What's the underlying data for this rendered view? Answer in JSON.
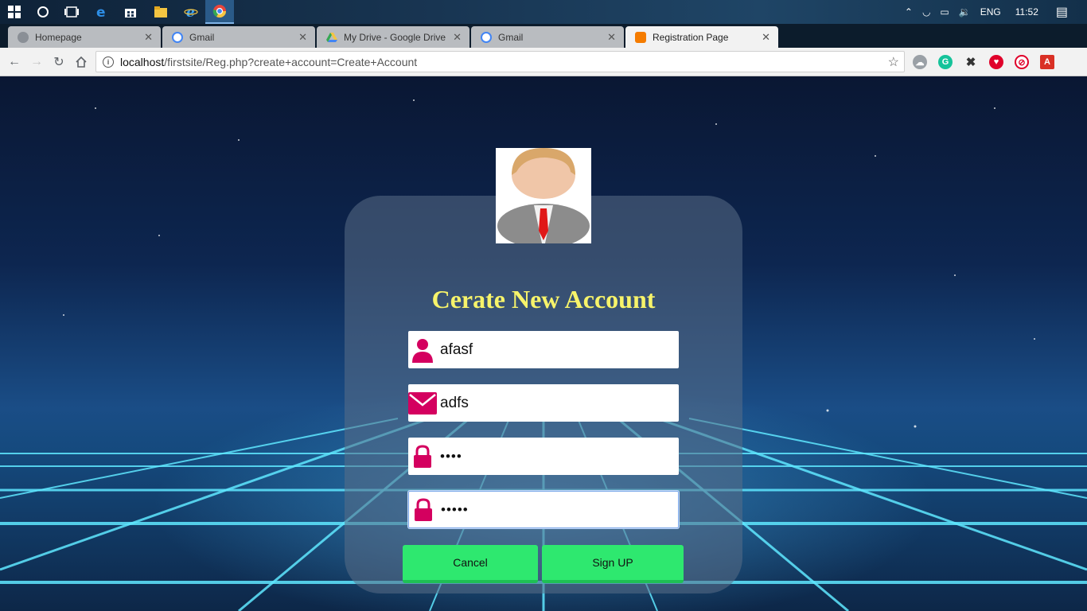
{
  "browser": {
    "tabs": [
      {
        "title": "Homepage",
        "favicon": "globe-icon",
        "active": false
      },
      {
        "title": "Gmail",
        "favicon": "google-icon",
        "active": false
      },
      {
        "title": "My Drive - Google Drive",
        "favicon": "drive-icon",
        "active": false
      },
      {
        "title": "Gmail",
        "favicon": "google-icon",
        "active": false
      },
      {
        "title": "Registration Page",
        "favicon": "xampp-icon",
        "active": true
      }
    ],
    "url_host": "localhost",
    "url_path": "/firstsite/Reg.php?create+account=Create+Account"
  },
  "taskbar": {
    "language": "ENG",
    "time": "11:52"
  },
  "form": {
    "title": "Cerate New Account",
    "fields": [
      {
        "icon": "user-icon",
        "value": "afasf",
        "type": "text"
      },
      {
        "icon": "envelope-icon",
        "value": "adfs",
        "type": "text"
      },
      {
        "icon": "lock-icon",
        "value": "••••",
        "type": "password"
      },
      {
        "icon": "lock-icon",
        "value": "•••••",
        "type": "password"
      }
    ],
    "cancel_label": "Cancel",
    "signup_label": "Sign UP"
  },
  "colors": {
    "accent_pink": "#d4005f",
    "button_green": "#2ee86f",
    "title_yellow": "#f7f36a"
  }
}
